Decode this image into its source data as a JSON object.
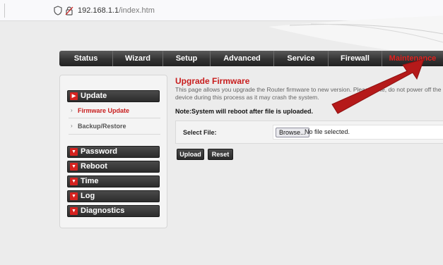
{
  "browser": {
    "url_host": "192.168.1.1",
    "url_path": "/index.htm"
  },
  "nav": {
    "tabs": [
      {
        "label": "Status",
        "name": "tab-status",
        "active": false
      },
      {
        "label": "Wizard",
        "name": "tab-wizard",
        "active": false
      },
      {
        "label": "Setup",
        "name": "tab-setup",
        "active": false
      },
      {
        "label": "Advanced",
        "name": "tab-advanced",
        "active": false
      },
      {
        "label": "Service",
        "name": "tab-service",
        "active": false
      },
      {
        "label": "Firewall",
        "name": "tab-firewall",
        "active": false
      },
      {
        "label": "Maintenance",
        "name": "tab-maintenance",
        "active": true
      }
    ]
  },
  "sidebar": {
    "update": "Update",
    "firmware_update": "Firmware Update",
    "backup_restore": "Backup/Restore",
    "password": "Password",
    "reboot": "Reboot",
    "time": "Time",
    "log": "Log",
    "diagnostics": "Diagnostics"
  },
  "content": {
    "title": "Upgrade Firmware",
    "description": "This page allows you upgrade the Router firmware to new version. Please note, do not power off the device during this process as it may crash the system.",
    "note": "Note:System will reboot after file is uploaded.",
    "select_file_label": "Select File:",
    "browse_label": "Browse...",
    "file_status": "No file selected.",
    "upload_label": "Upload",
    "reset_label": "Reset"
  },
  "colors": {
    "accent_red": "#c81c1c",
    "nav_dark": "#333333",
    "arrow_red": "#b51a1a"
  },
  "icons": {
    "shield": "shield-icon",
    "lock": "lock-icon",
    "expand": "chevron-right-icon",
    "collapse": "chevron-down-icon"
  }
}
